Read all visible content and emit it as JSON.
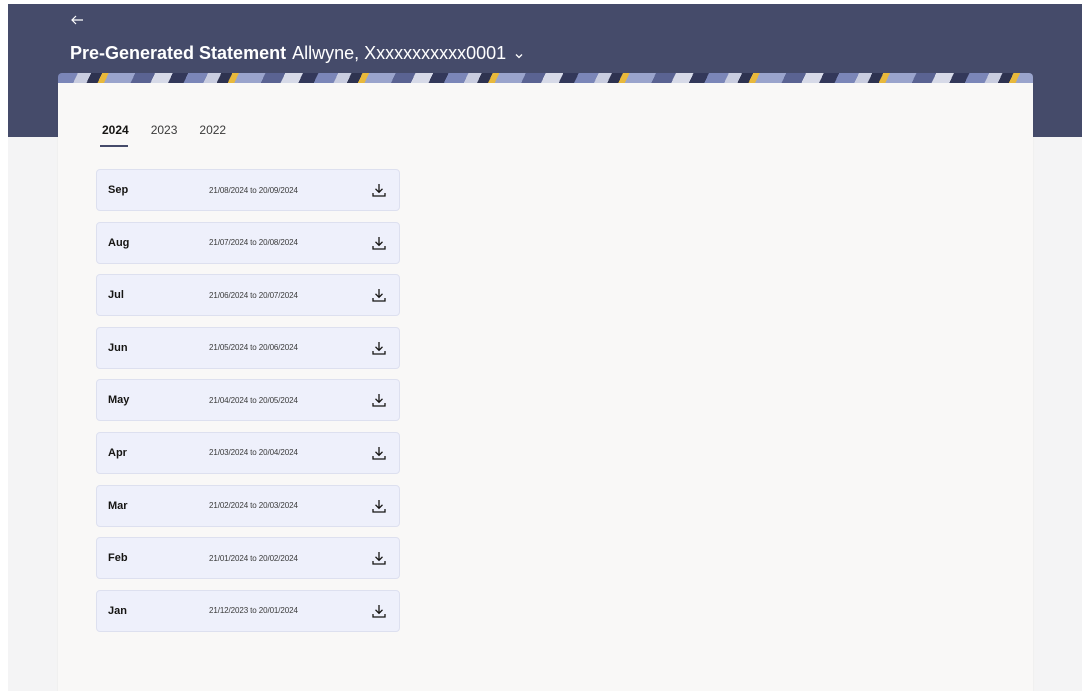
{
  "header": {
    "back_icon": "arrow-left-icon",
    "title": "Pre-Generated Statement",
    "account": "Allwyne, Xxxxxxxxxxx0001",
    "dropdown_icon": "chevron-down-icon",
    "colors": {
      "band": "#454b6a",
      "card": "#f9f8f7",
      "row": "#eef0fb"
    }
  },
  "tabs": [
    {
      "label": "2024",
      "active": true
    },
    {
      "label": "2023",
      "active": false
    },
    {
      "label": "2022",
      "active": false
    }
  ],
  "statements": [
    {
      "month": "Sep",
      "range": "21/08/2024 to 20/09/2024",
      "icon": "download-icon"
    },
    {
      "month": "Aug",
      "range": "21/07/2024 to 20/08/2024",
      "icon": "download-icon"
    },
    {
      "month": "Jul",
      "range": "21/06/2024 to 20/07/2024",
      "icon": "download-icon"
    },
    {
      "month": "Jun",
      "range": "21/05/2024 to 20/06/2024",
      "icon": "download-icon"
    },
    {
      "month": "May",
      "range": "21/04/2024 to 20/05/2024",
      "icon": "download-icon"
    },
    {
      "month": "Apr",
      "range": "21/03/2024 to 20/04/2024",
      "icon": "download-icon"
    },
    {
      "month": "Mar",
      "range": "21/02/2024 to 20/03/2024",
      "icon": "download-icon"
    },
    {
      "month": "Feb",
      "range": "21/01/2024 to 20/02/2024",
      "icon": "download-icon"
    },
    {
      "month": "Jan",
      "range": "21/12/2023 to 20/01/2024",
      "icon": "download-icon"
    }
  ]
}
